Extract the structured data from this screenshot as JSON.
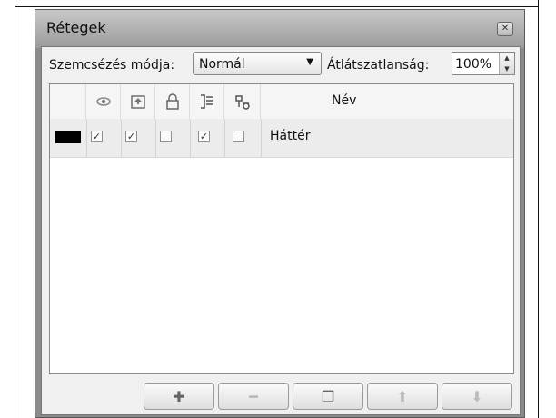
{
  "window": {
    "title": "Rétegek",
    "close_label": "✕"
  },
  "toolbar": {
    "blend_mode_label": "Szemcsézés módja:",
    "blend_mode_value": "Normál",
    "opacity_label": "Átlátszatlanság:",
    "opacity_value": "100%"
  },
  "grid": {
    "header": {
      "icons": [
        "eye-icon",
        "paint-layer-icon",
        "lock-icon",
        "mask-icon",
        "link-icon"
      ],
      "name_label": "Név"
    },
    "rows": [
      {
        "color": "#000000",
        "checks": [
          "✓",
          "✓",
          "",
          "✓",
          ""
        ],
        "name": "Háttér"
      }
    ]
  },
  "buttons": {
    "add": "✚",
    "remove": "━",
    "duplicate": "❐",
    "up": "⬆",
    "down": "⬇"
  }
}
